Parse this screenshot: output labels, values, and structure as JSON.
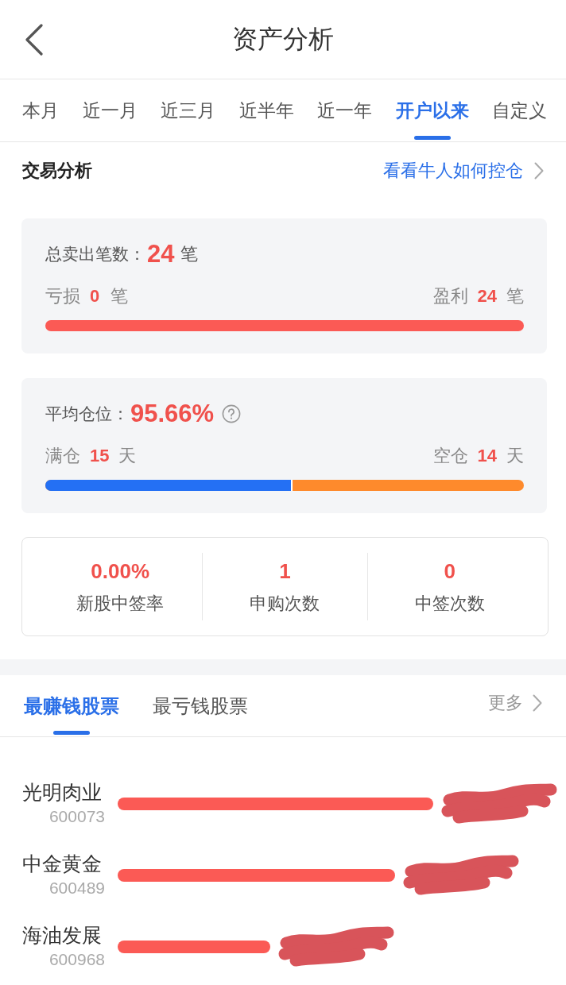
{
  "header": {
    "title": "资产分析"
  },
  "period_tabs": [
    {
      "label": "本月",
      "selected": false
    },
    {
      "label": "近一月",
      "selected": false
    },
    {
      "label": "近三月",
      "selected": false
    },
    {
      "label": "近半年",
      "selected": false
    },
    {
      "label": "近一年",
      "selected": false
    },
    {
      "label": "开户以来",
      "selected": true
    },
    {
      "label": "自定义",
      "selected": false
    }
  ],
  "trade_analysis": {
    "title": "交易分析",
    "link": "看看牛人如何控仓"
  },
  "summary_cards": [
    {
      "kind": "trades",
      "label": "总卖出笔数：",
      "value": "24",
      "unit": "笔",
      "left": {
        "label": "亏损",
        "value": "0",
        "unit": "笔"
      },
      "right": {
        "label": "盈利",
        "value": "24",
        "unit": "笔"
      }
    },
    {
      "kind": "position",
      "label": "平均仓位：",
      "value": "95.66%",
      "help_icon": true,
      "left": {
        "label": "满仓",
        "value": "15",
        "unit": "天"
      },
      "right": {
        "label": "空仓",
        "value": "14",
        "unit": "天"
      },
      "level": 0.517
    }
  ],
  "ipo_stats": [
    {
      "value": "0.00%",
      "label": "新股中签率"
    },
    {
      "value": "1",
      "label": "申购次数"
    },
    {
      "value": "0",
      "label": "中签次数"
    }
  ],
  "stock_tabs": [
    {
      "label": "最赚钱股票",
      "selected": true
    },
    {
      "label": "最亏钱股票",
      "selected": false
    }
  ],
  "more_link": "更多",
  "stocks": [
    {
      "name": "光明肉业",
      "code": "600073",
      "redacted": true
    },
    {
      "name": "中金黄金",
      "code": "600489",
      "redacted": true
    },
    {
      "name": "海油发展",
      "code": "600968",
      "redacted": true
    }
  ]
}
